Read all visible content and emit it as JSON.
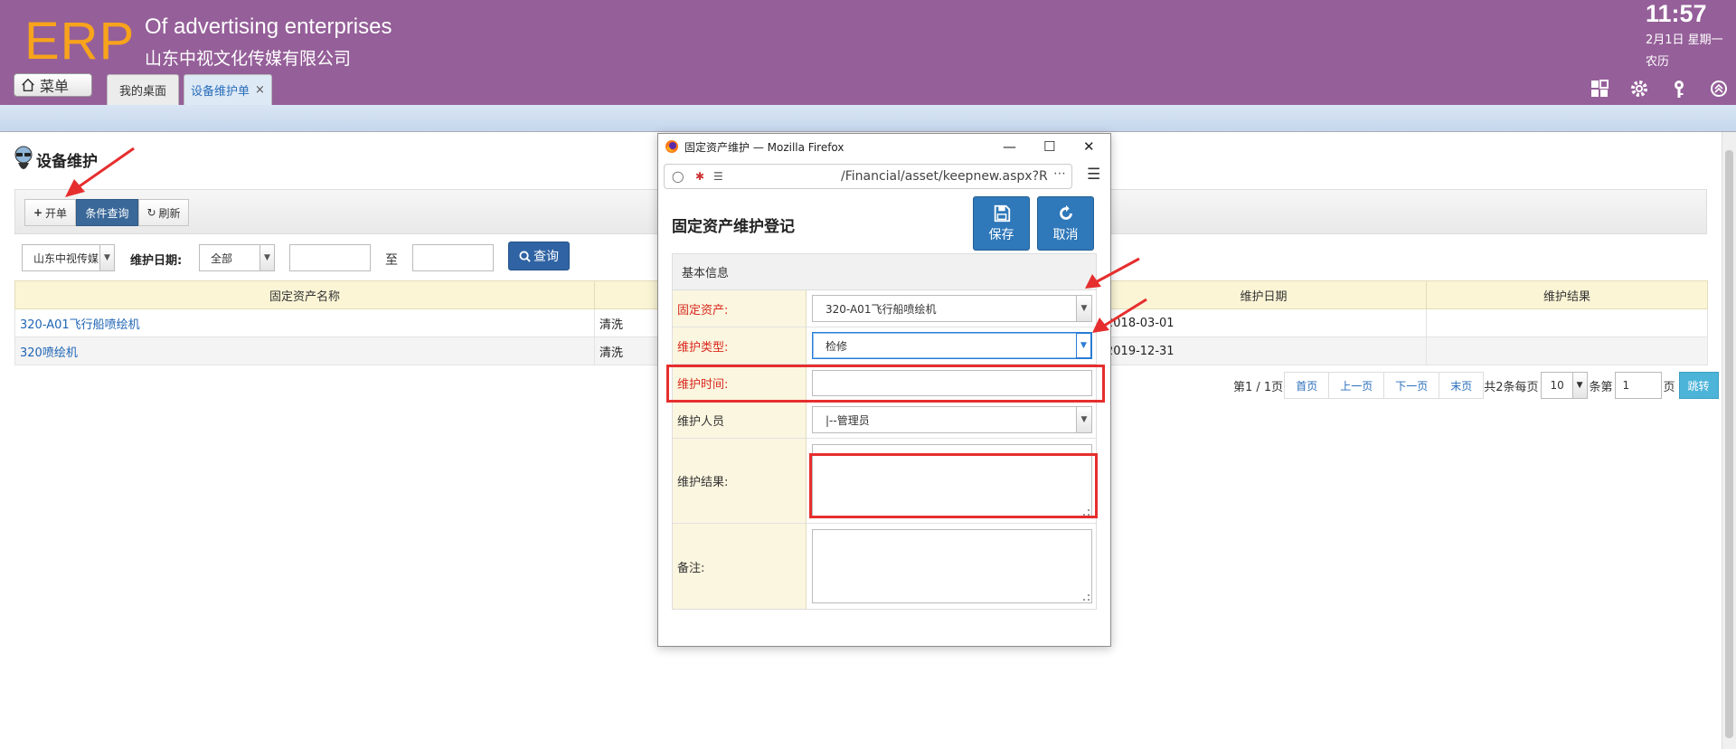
{
  "header": {
    "logo": "ERP",
    "company_en": "Of advertising enterprises",
    "company_cn": "山东中视文化传媒有限公司",
    "time": "11:57",
    "date": "2月1日 星期一",
    "lunar": "农历",
    "menu_label": "菜单",
    "tabs": [
      {
        "label": "我的桌面"
      },
      {
        "label": "设备维护单",
        "close": "×"
      }
    ],
    "icons": [
      "apps-grid-icon",
      "gear-icon",
      "key-icon",
      "collapse-up-icon"
    ]
  },
  "page": {
    "title": "设备维护",
    "toolbar": {
      "open": "开单",
      "query": "条件查询",
      "refresh": "刷新"
    },
    "filter": {
      "company": "山东中视传媒",
      "date_label": "维护日期:",
      "range": "全部",
      "to": "至",
      "search": "查询"
    },
    "table": {
      "columns": [
        "固定资产名称",
        "",
        "",
        "",
        "维护日期",
        "维护结果"
      ],
      "rows": [
        {
          "name": "320-A01飞行船喷绘机",
          "type": "清洗",
          "date": "2018-03-01",
          "result": ""
        },
        {
          "name": "320喷绘机",
          "type": "清洗",
          "date": "2019-12-31",
          "result": ""
        }
      ]
    },
    "pager": {
      "page_info": "第1 / 1页",
      "first": "首页",
      "prev": "上一页",
      "next": "下一页",
      "last": "末页",
      "total": "共2条每页",
      "page_size": "10",
      "unit": "条第",
      "page_input": "1",
      "page_unit": "页",
      "jump": "跳转"
    }
  },
  "popup": {
    "window_title": "固定资产维护 — Mozilla Firefox",
    "url": "/Financial/asset/keepnew.aspx?R",
    "form_title": "固定资产维护登记",
    "save": "保存",
    "cancel": "取消",
    "section": "基本信息",
    "fields": {
      "asset_label": "固定资产:",
      "asset_value": "320-A01飞行船喷绘机",
      "type_label": "维护类型:",
      "type_value": "检修",
      "time_label": "维护时间:",
      "person_label": "维护人员",
      "person_value": "|--管理员",
      "result_label": "维护结果:",
      "remark_label": "备注:"
    }
  },
  "colors": {
    "header_bg": "#955f99",
    "logo": "#f7a31c",
    "link": "#1f65b5",
    "required": "#d9281e",
    "highlight": "#e62e2e",
    "primary_button": "#2f78b9"
  }
}
